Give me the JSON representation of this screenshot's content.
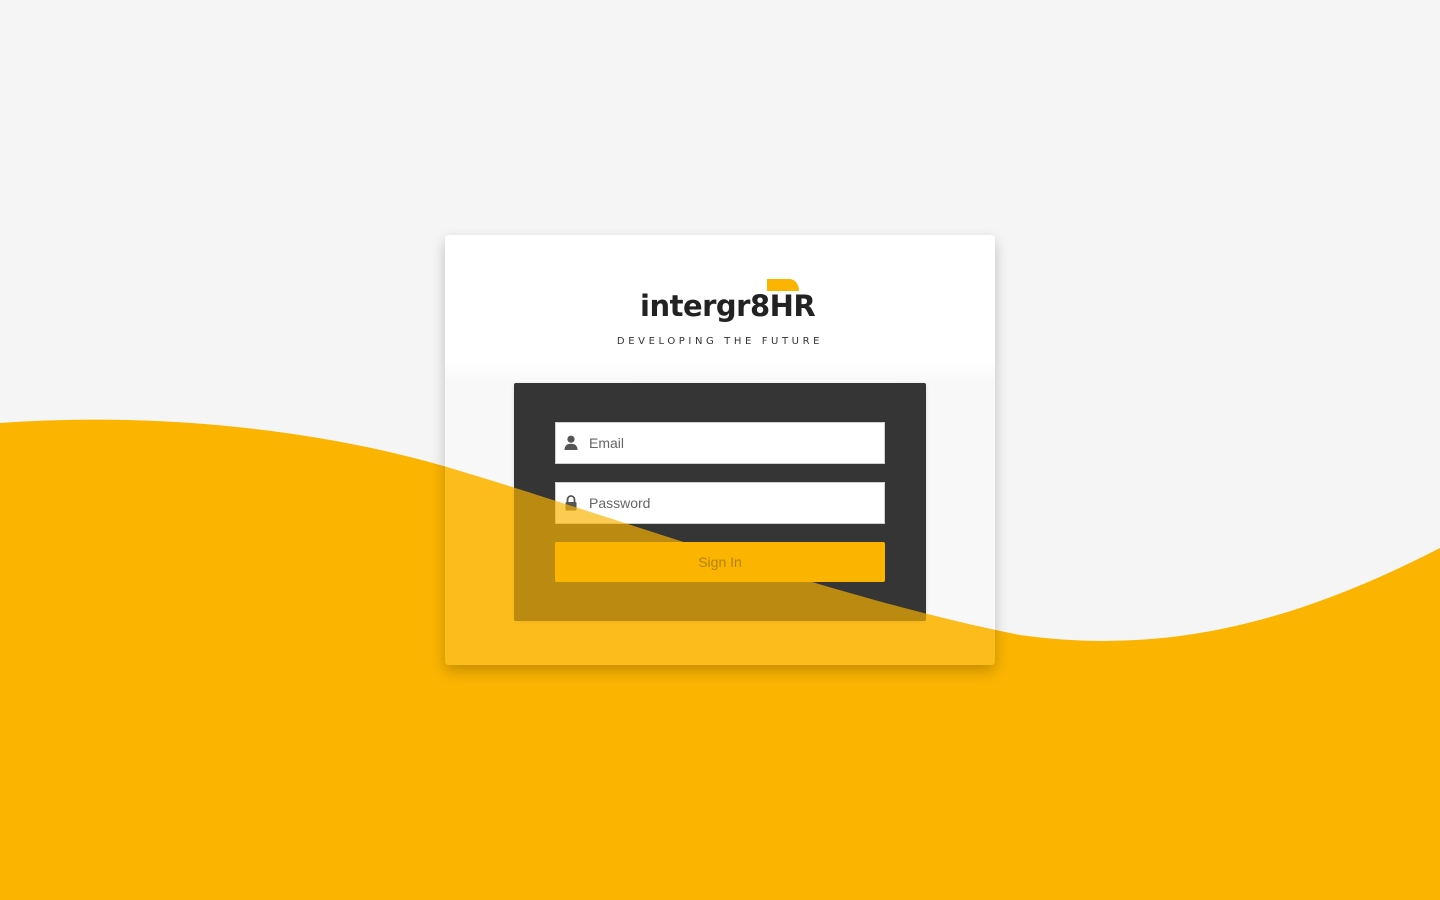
{
  "colors": {
    "accent": "#fbb400",
    "background": "#f5f5f5",
    "panel": "#353535",
    "text_dark": "#222222"
  },
  "brand": {
    "name": "intergr8HR",
    "tagline": "DEVELOPING THE FUTURE"
  },
  "login_form": {
    "email": {
      "placeholder": "Email",
      "value": "",
      "icon": "user-icon"
    },
    "password": {
      "placeholder": "Password",
      "value": "",
      "icon": "lock-icon"
    },
    "submit_label": "Sign In"
  }
}
